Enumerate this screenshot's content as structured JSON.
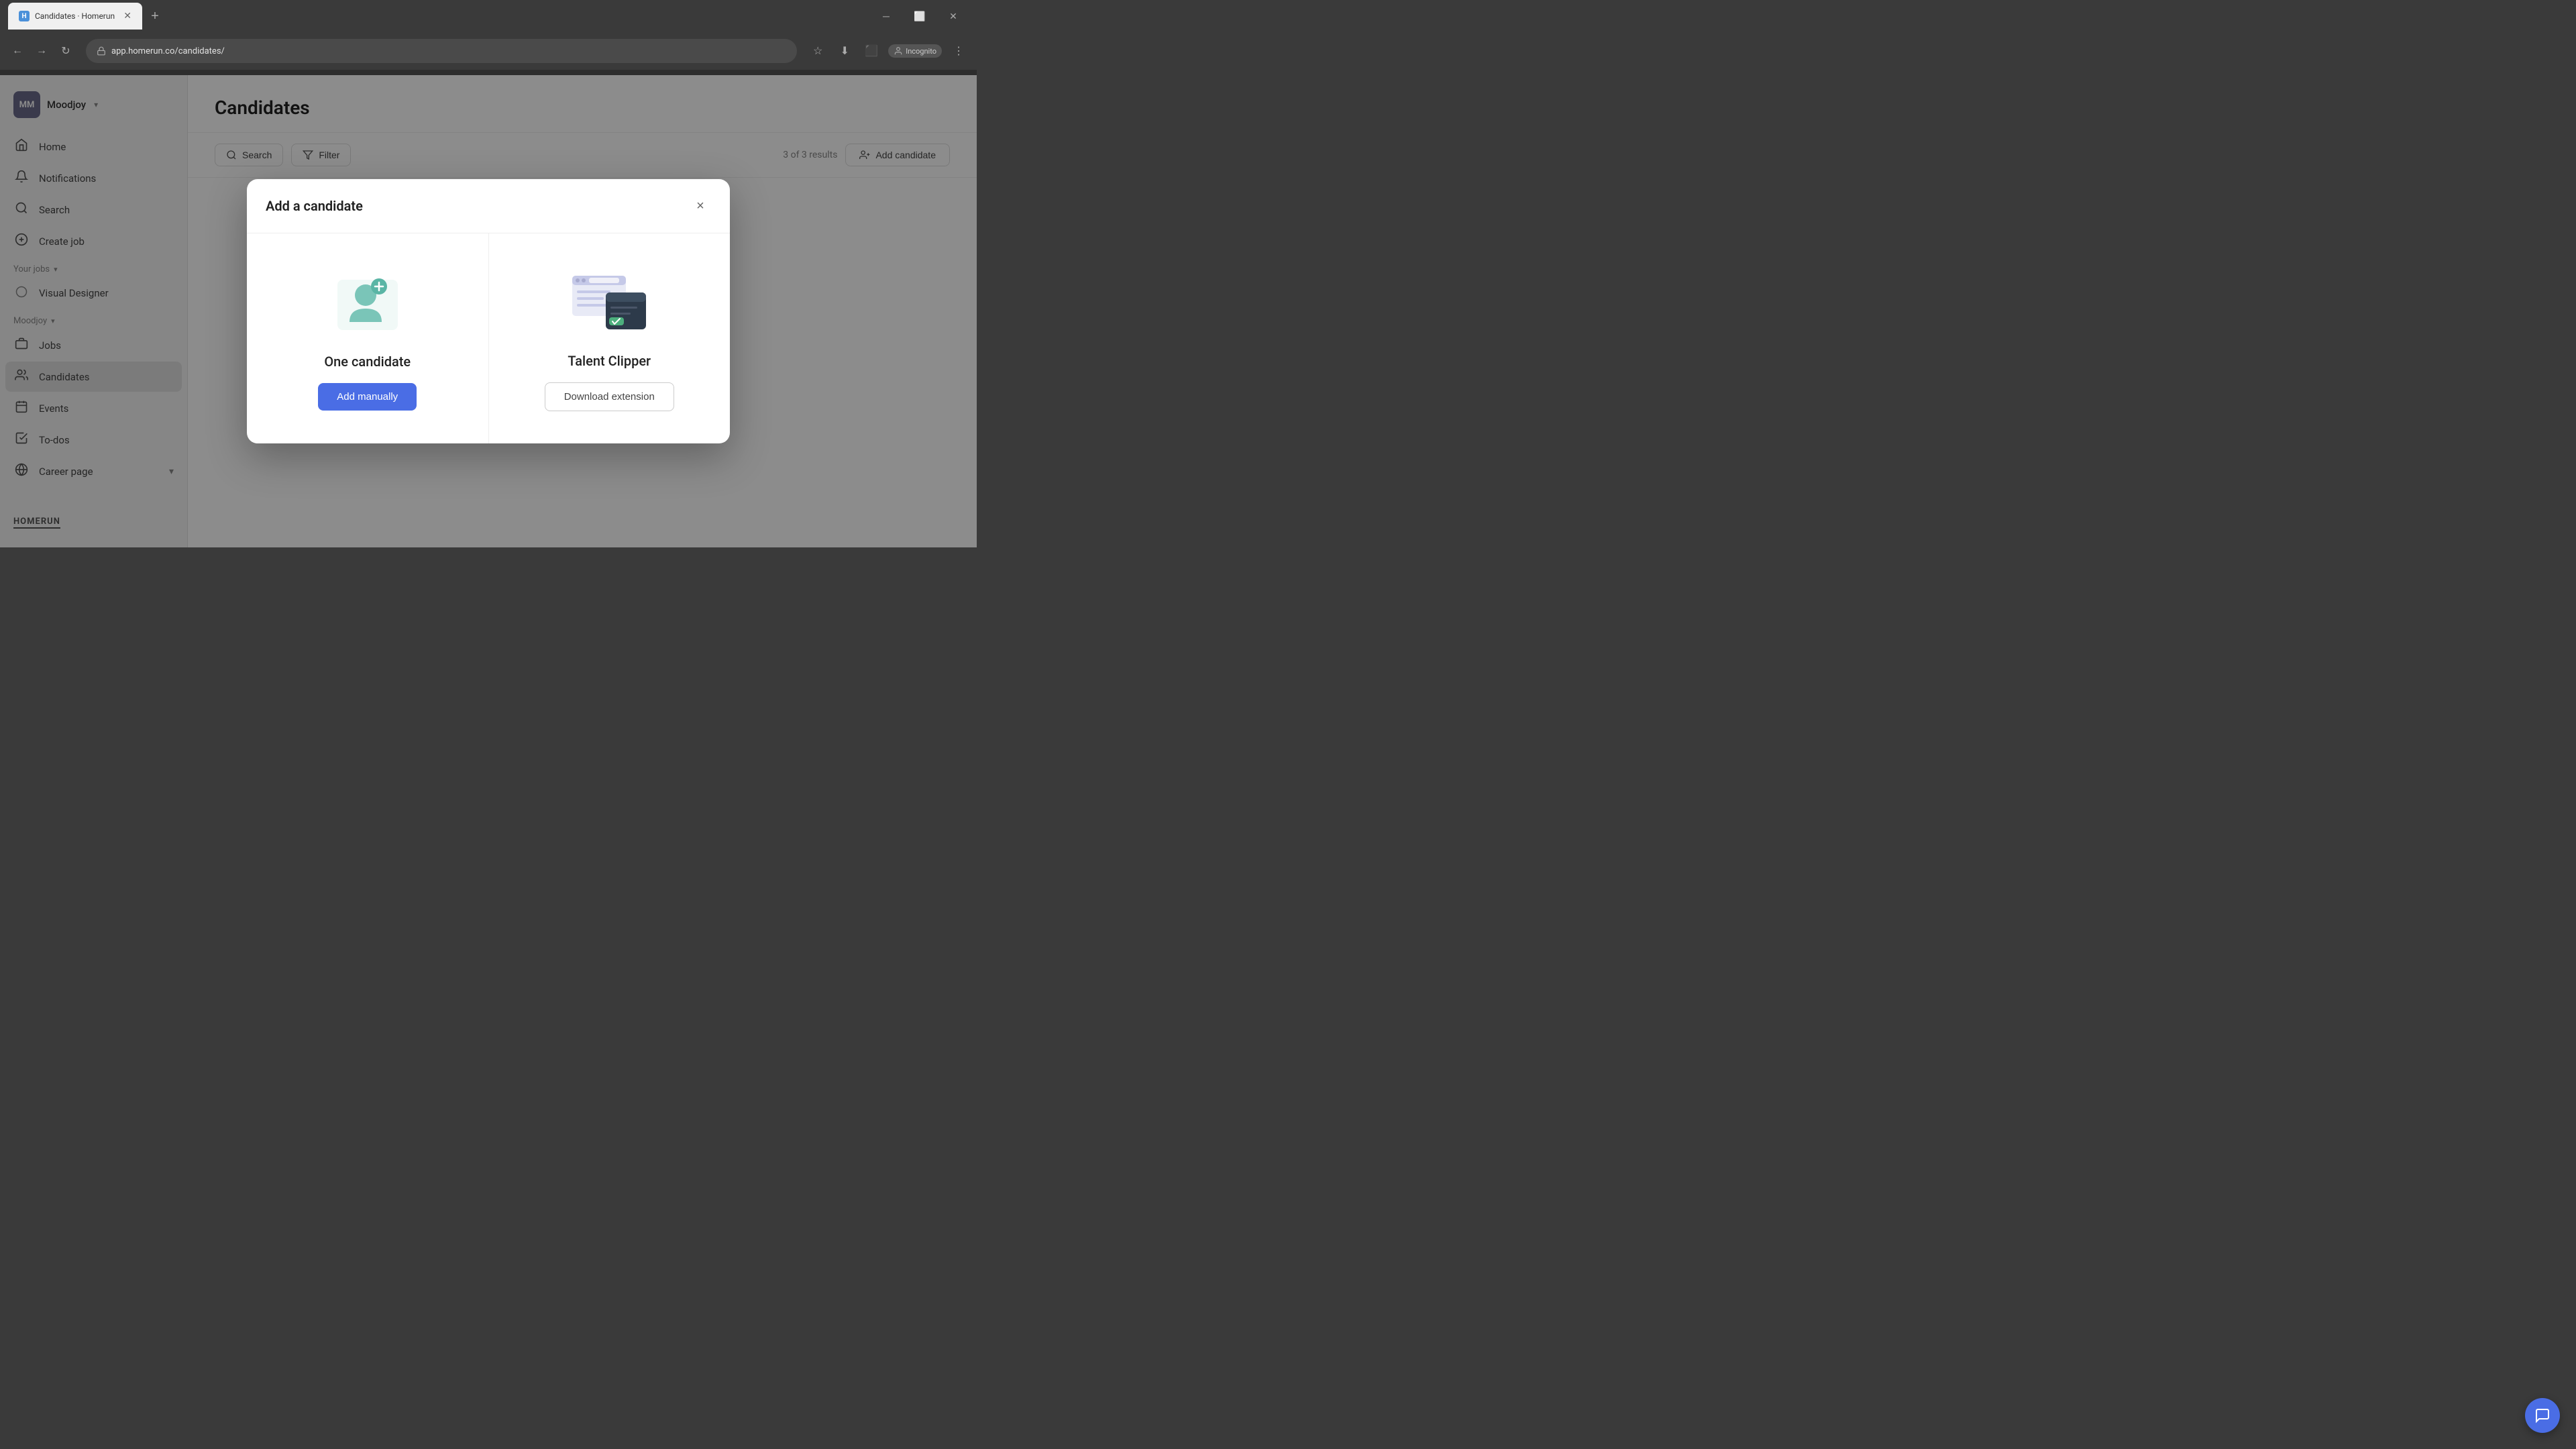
{
  "browser": {
    "url": "app.homerun.co/candidates/",
    "tab_title": "Candidates · Homerun",
    "tab_favicon": "H",
    "incognito_label": "Incognito"
  },
  "sidebar": {
    "user_initials": "MM",
    "user_name": "Moodjoy",
    "nav_items": [
      {
        "id": "home",
        "label": "Home",
        "icon": "⌂"
      },
      {
        "id": "notifications",
        "label": "Notifications",
        "icon": "🔔"
      },
      {
        "id": "search",
        "label": "Search",
        "icon": "🔍"
      },
      {
        "id": "create-job",
        "label": "Create job",
        "icon": "+"
      }
    ],
    "your_jobs_label": "Your jobs",
    "jobs": [
      {
        "id": "visual-designer",
        "label": "Visual Designer"
      }
    ],
    "moodjoy_label": "Moodjoy",
    "moodjoy_items": [
      {
        "id": "jobs",
        "label": "Jobs",
        "icon": "📋"
      },
      {
        "id": "candidates",
        "label": "Candidates",
        "icon": "👥"
      },
      {
        "id": "events",
        "label": "Events",
        "icon": "📅"
      },
      {
        "id": "todos",
        "label": "To-dos",
        "icon": "✅"
      },
      {
        "id": "career-page",
        "label": "Career page",
        "icon": "🌐"
      }
    ],
    "logo_text": "HOMERUN"
  },
  "main": {
    "title": "Candidates",
    "search_label": "Search",
    "filter_label": "Filter",
    "results_count": "3 of 3 results",
    "add_candidate_label": "Add candidate"
  },
  "modal": {
    "title": "Add a candidate",
    "close_label": "×",
    "option_one": {
      "title": "One candidate",
      "button_label": "Add manually"
    },
    "option_two": {
      "title": "Talent Clipper",
      "button_label": "Download extension"
    }
  },
  "chat": {
    "icon": "💬"
  }
}
